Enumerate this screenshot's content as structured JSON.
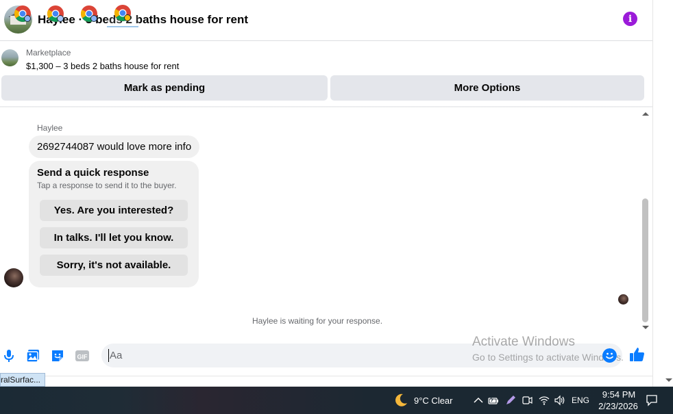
{
  "header": {
    "title": "Haylee · 3 beds 2 baths house for rent",
    "info_icon": "info-icon",
    "info_glyph": "i",
    "accent_color": "#9b1bd9"
  },
  "listing": {
    "source_label": "Marketplace",
    "summary": "$1,300 – 3 beds 2 baths house for rent"
  },
  "actions": {
    "mark_pending_label": "Mark as pending",
    "more_options_label": "More Options"
  },
  "conversation": {
    "sender_name": "Haylee",
    "message_text": "2692744087 would love more info",
    "quick_response": {
      "title": "Send a quick response",
      "subtitle": "Tap a response to send it to the buyer.",
      "options": [
        "Yes. Are you interested?",
        "In talks. I'll let you know.",
        "Sorry, it's not available."
      ]
    },
    "waiting_status": "Haylee is waiting for your response."
  },
  "composer": {
    "placeholder": "Aa",
    "icons": [
      "microphone-icon",
      "photo-icon",
      "sticker-icon",
      "gif-icon",
      "emoji-icon",
      "thumbs-up-icon"
    ],
    "gif_label": "GIF",
    "brand_color": "#0a7cff"
  },
  "watermark": {
    "title": "Activate Windows",
    "subtitle": "Go to Settings to activate Windows."
  },
  "tooltip_fragment": "ralSurfac...",
  "taskbar": {
    "apps": [
      "chrome-icon",
      "chrome-icon",
      "chrome-icon",
      "chrome-icon"
    ],
    "weather": {
      "icon": "moon-icon",
      "text": "9°C  Clear"
    },
    "language": "ENG",
    "time": "9:54 PM",
    "date": "2/23/2026",
    "tray_icons": [
      "chevron-up-icon",
      "battery-icon",
      "pen-icon",
      "meet-icon",
      "wifi-icon",
      "volume-icon",
      "notification-icon"
    ]
  }
}
